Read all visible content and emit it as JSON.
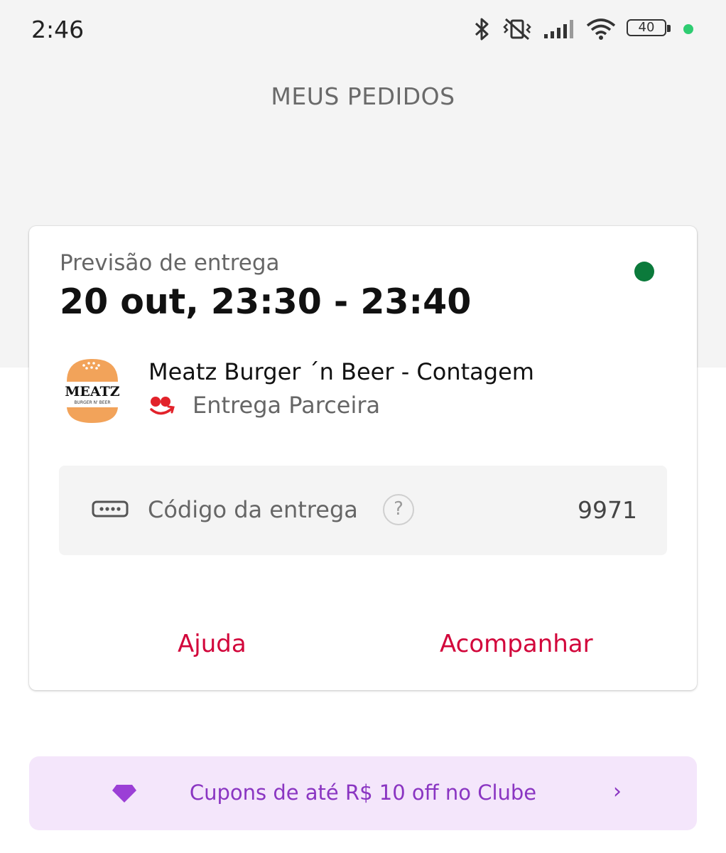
{
  "status_bar": {
    "time": "2:46",
    "battery_level": "40",
    "icons": [
      "bluetooth-icon",
      "vibrate-icon",
      "signal-icon",
      "wifi-icon",
      "battery-icon",
      "active-dot"
    ]
  },
  "header": {
    "title": "MEUS PEDIDOS"
  },
  "order": {
    "eta_label": "Previsão de entrega",
    "eta_value": "20 out, 23:30 - 23:40",
    "status_color": "#0b7a3b",
    "store_name": "Meatz Burger ´n Beer - Contagem",
    "store_logo_text": "MEATZ",
    "store_logo_subtext": "BURGER N' BEER",
    "delivery_type": "Entrega Parceira",
    "code_label": "Código da entrega",
    "code_help": "?",
    "code_value": "9971",
    "help_button": "Ajuda",
    "track_button": "Acompanhar"
  },
  "club_banner": {
    "text": "Cupons de até R$ 10 off no Clube",
    "chevron": "›"
  },
  "colors": {
    "accent_red": "#d2063b",
    "club_purple": "#8a35c2",
    "club_bg": "#f4e6fb"
  }
}
